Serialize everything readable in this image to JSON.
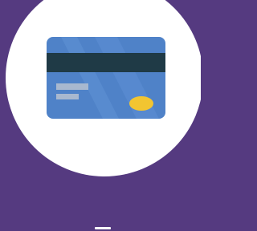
{
  "icon": {
    "name": "credit-card-icon",
    "colors": {
      "background": "#553A80",
      "circle": "#FFFFFF",
      "card_body": "#4F82C8",
      "card_stripe_light": "#6193D6",
      "magnetic_strip": "#1F3A46",
      "text_lines": "#A8B8CF",
      "chip": "#F2C531"
    }
  }
}
